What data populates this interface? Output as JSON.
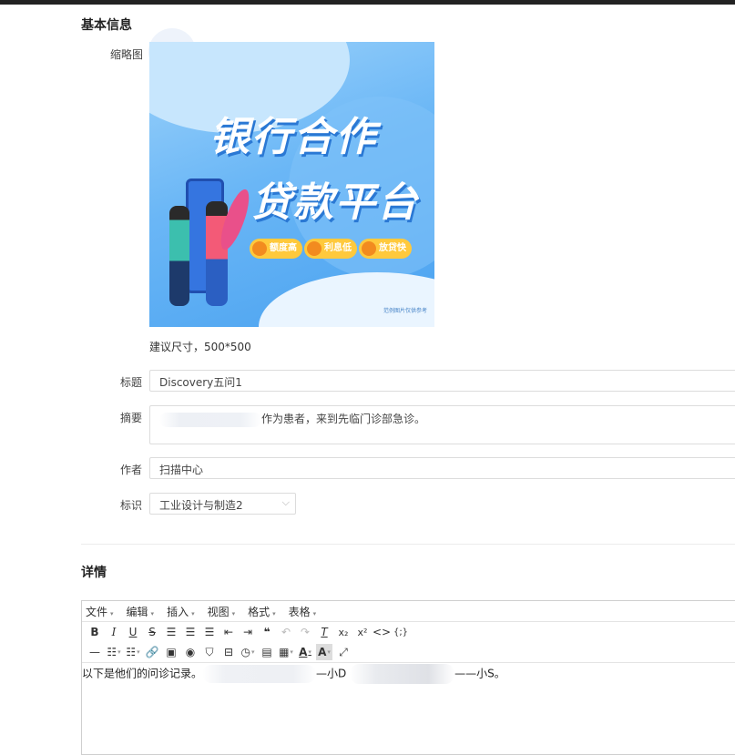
{
  "section_basic": "基本信息",
  "section_detail": "详情",
  "thumbnail": {
    "label": "缩略图",
    "banner_line1": "银行合作",
    "banner_line2": "贷款平台",
    "pills": [
      "额度高",
      "利息低",
      "放贷快"
    ],
    "footer_text": "范例图片仅供参考",
    "hint": "建议尺寸，500*500"
  },
  "fields": {
    "title": {
      "label": "标题",
      "value": "Discovery五问1"
    },
    "summary": {
      "label": "摘要",
      "value_visible": "作为患者，来到先临门诊部急诊。"
    },
    "author": {
      "label": "作者",
      "value": "扫描中心"
    },
    "tag": {
      "label": "标识",
      "value": "工业设计与制造2"
    }
  },
  "editor": {
    "menus": [
      "文件",
      "编辑",
      "插入",
      "视图",
      "格式",
      "表格"
    ],
    "toolbar_row1": [
      "bold-icon",
      "italic-icon",
      "underline-icon",
      "strikethrough-icon",
      "align-left-icon",
      "align-center-icon",
      "align-right-icon",
      "outdent-icon",
      "indent-icon",
      "blockquote-icon",
      "undo-icon",
      "redo-icon",
      "clear-format-icon",
      "subscript-icon",
      "superscript-icon",
      "code-icon",
      "code-sample-icon"
    ],
    "toolbar_row2": [
      "hr-icon",
      "bullet-list-icon",
      "numbered-list-icon",
      "link-icon",
      "image-icon",
      "preview-icon",
      "bookmark-icon",
      "page-break-icon",
      "time-icon",
      "template-icon",
      "table-icon",
      "text-color-icon",
      "background-color-icon",
      "fullscreen-icon"
    ],
    "content_part1": "以下是他们的问诊记录。",
    "content_part2": "—小D",
    "content_part3": "——小S。"
  },
  "colors": {
    "banner_blue": "#5aaef5",
    "pill_yellow": "#ffc93c",
    "topbar": "#222222"
  }
}
